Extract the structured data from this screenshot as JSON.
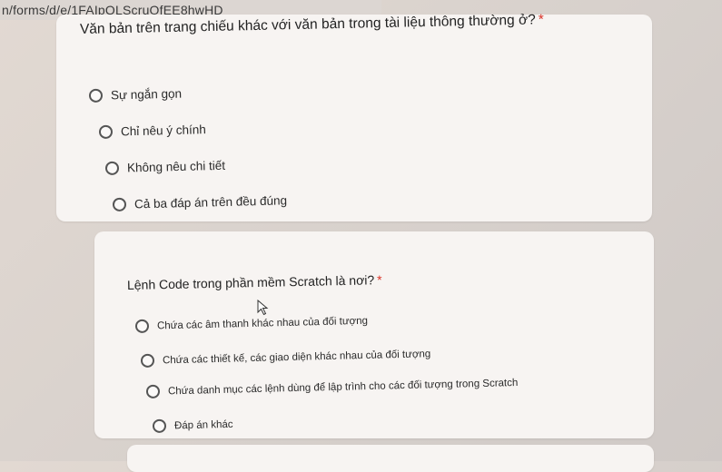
{
  "browser": {
    "url": "n/forms/d/e/1FAIpQLScruOfEE8hwHD"
  },
  "questions": [
    {
      "title": "Văn bản trên trang chiếu khác với văn bản trong tài liệu thông thường ở?",
      "required_marker": "*",
      "options": [
        "Sự ngắn gọn",
        "Chỉ nêu ý chính",
        "Không nêu chi tiết",
        "Cả ba đáp án trên đều đúng"
      ]
    },
    {
      "title": "Lệnh Code trong phần mềm Scratch là nơi?",
      "required_marker": "*",
      "options": [
        "Chứa các âm thanh khác nhau của đối tượng",
        "Chứa các thiết kế, các giao diện khác nhau của đối tượng",
        "Chứa danh mục các lệnh dùng để lập trình cho các đối tượng trong Scratch",
        "Đáp án khác"
      ]
    }
  ],
  "colors": {
    "card_background": "#f7f4f2",
    "required_marker": "#d93025",
    "page_background": "#d9d2cd"
  }
}
